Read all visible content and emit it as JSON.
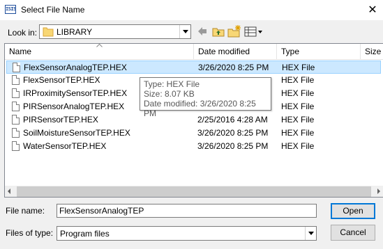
{
  "window": {
    "title": "Select File Name",
    "app_icon_text": "ISIS"
  },
  "toolbar": {
    "lookin_label": "Look in:",
    "lookin_value": "LIBRARY"
  },
  "columns": {
    "name": "Name",
    "date": "Date modified",
    "type": "Type",
    "size": "Size"
  },
  "files": [
    {
      "name": "FlexSensorAnalogTEP.HEX",
      "date": "3/26/2020 8:25 PM",
      "type": "HEX File",
      "selected": true
    },
    {
      "name": "FlexSensorTEP.HEX",
      "date": "",
      "type": "HEX File"
    },
    {
      "name": "IRProximitySensorTEP.HEX",
      "date": "",
      "type": "HEX File"
    },
    {
      "name": "PIRSensorAnalogTEP.HEX",
      "date": "",
      "type": "HEX File"
    },
    {
      "name": "PIRSensorTEP.HEX",
      "date": "2/25/2016 4:28 AM",
      "type": "HEX File"
    },
    {
      "name": "SoilMoistureSensorTEP.HEX",
      "date": "3/26/2020 8:25 PM",
      "type": "HEX File"
    },
    {
      "name": "WaterSensorTEP.HEX",
      "date": "3/26/2020 8:25 PM",
      "type": "HEX File"
    }
  ],
  "tooltip": {
    "type": "Type: HEX File",
    "size": "Size: 8.07 KB",
    "date": "Date modified: 3/26/2020 8:25 PM"
  },
  "form": {
    "filename_label": "File name:",
    "filename_value": "FlexSensorAnalogTEP",
    "filetype_label": "Files of type:",
    "filetype_value": "Program files"
  },
  "buttons": {
    "open": "Open",
    "cancel": "Cancel"
  },
  "colors": {
    "selection": "#cce8ff",
    "accent": "#0078d7"
  }
}
